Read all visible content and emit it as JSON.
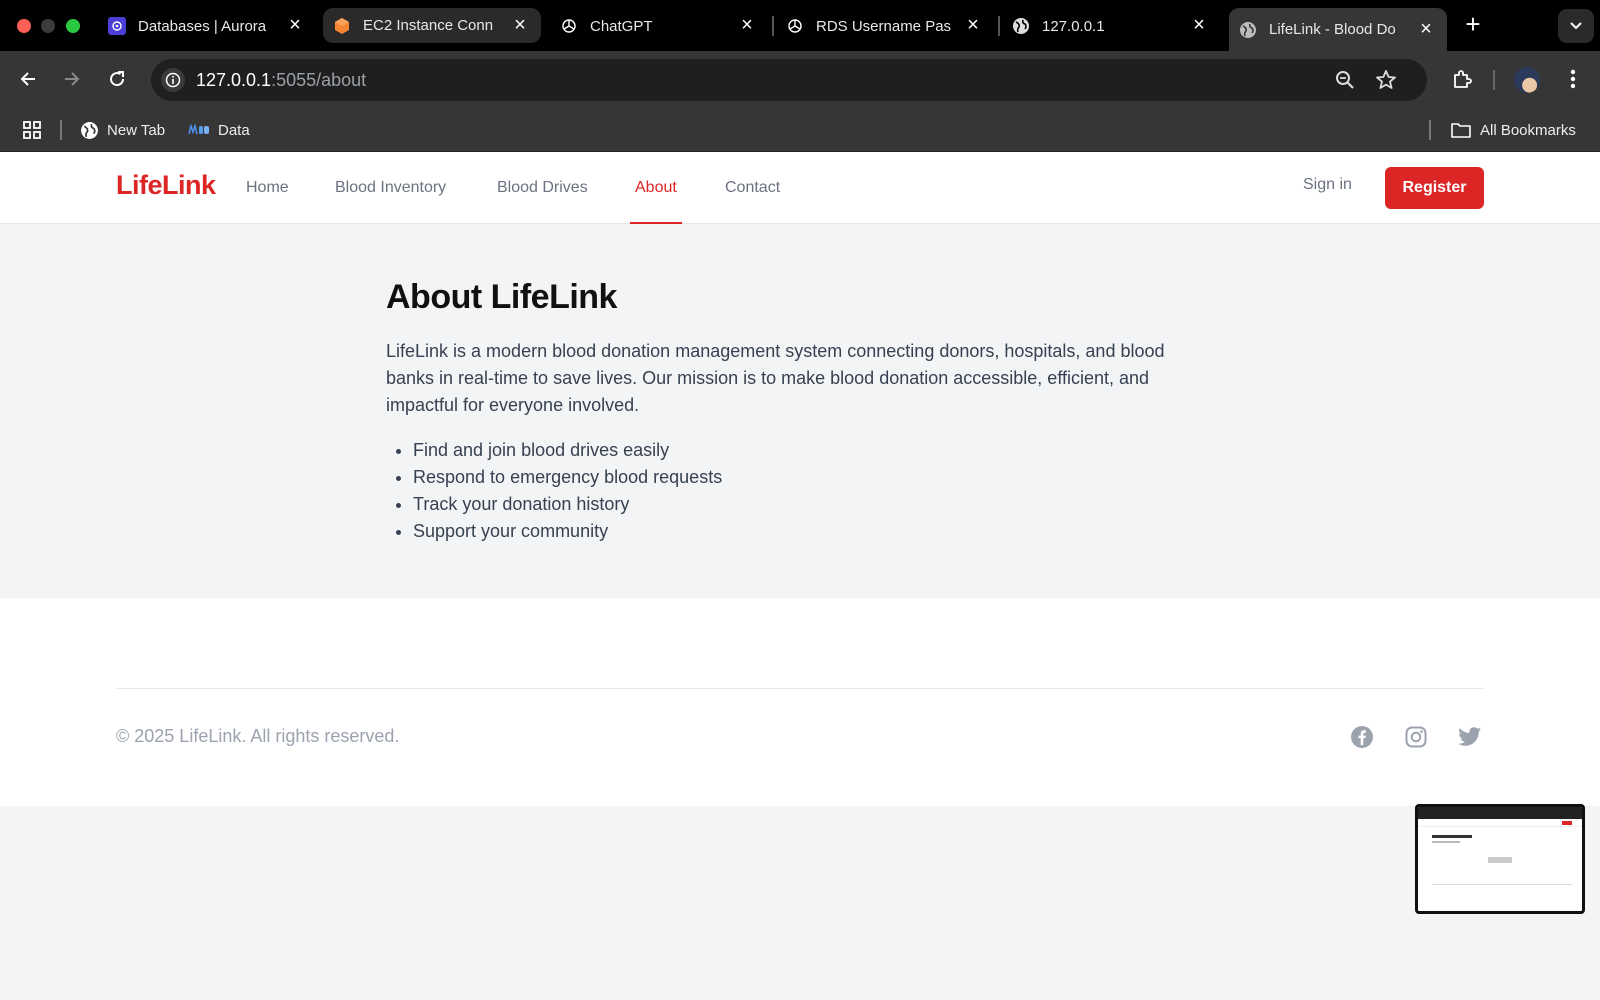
{
  "browser": {
    "tabs": [
      {
        "title": "Databases | Aurora",
        "icon": "aurora-db-icon"
      },
      {
        "title": "EC2 Instance Conn",
        "icon": "aws-ec2-icon"
      },
      {
        "title": "ChatGPT",
        "icon": "chatgpt-icon"
      },
      {
        "title": "RDS Username Pas",
        "icon": "chatgpt-icon"
      },
      {
        "title": "127.0.0.1",
        "icon": "globe-icon"
      },
      {
        "title": "LifeLink - Blood Do",
        "icon": "globe-icon"
      }
    ],
    "address": {
      "host": "127.0.0.1",
      "path": ":5055/about"
    },
    "bookmarks": [
      {
        "label": "New Tab",
        "icon": "globe-icon"
      },
      {
        "label": "Data",
        "icon": "mdb-icon"
      }
    ],
    "all_bookmarks_label": "All Bookmarks"
  },
  "site": {
    "logo": "LifeLink",
    "nav": {
      "home": "Home",
      "inventory": "Blood Inventory",
      "drives": "Blood Drives",
      "about": "About",
      "contact": "Contact"
    },
    "signin": "Sign in",
    "register": "Register",
    "accent_color": "#dc2626"
  },
  "about": {
    "title": "About LifeLink",
    "description": "LifeLink is a modern blood donation management system connecting donors, hospitals, and blood banks in real-time to save lives. Our mission is to make blood donation accessible, efficient, and impactful for everyone involved.",
    "features": [
      "Find and join blood drives easily",
      "Respond to emergency blood requests",
      "Track your donation history",
      "Support your community"
    ]
  },
  "footer": {
    "copyright": "© 2025 LifeLink. All rights reserved.",
    "social": [
      "facebook-icon",
      "instagram-icon",
      "twitter-icon"
    ]
  }
}
